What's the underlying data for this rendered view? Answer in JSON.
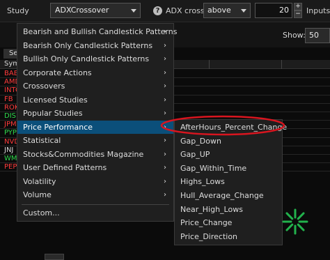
{
  "toolbar": {
    "study_label": "Study",
    "study_value": "ADXCrossover",
    "help_glyph": "?",
    "adx_label": "ADX crosses",
    "condition_value": "above",
    "threshold_value": "20",
    "stepper_up": "+",
    "stepper_down": "−",
    "inputs_label": "Inputs"
  },
  "view": {
    "show_label": "Show:",
    "show_value": "50"
  },
  "table": {
    "tab_label": "Sea",
    "symbol_header": "Sym",
    "rows": [
      {
        "symbol": "BABA",
        "status": "neg"
      },
      {
        "symbol": "AMD",
        "status": "neg"
      },
      {
        "symbol": "INTC",
        "status": "neg"
      },
      {
        "symbol": "FB",
        "status": "neg"
      },
      {
        "symbol": "ROKU",
        "status": "neg"
      },
      {
        "symbol": "DIS",
        "status": "pos"
      },
      {
        "symbol": "JPM",
        "status": "neg"
      },
      {
        "symbol": "PYPL",
        "status": "pos"
      },
      {
        "symbol": "NVDA",
        "status": "neg"
      },
      {
        "symbol": "JNJ",
        "status": "neu"
      },
      {
        "symbol": "WMT",
        "status": "pos"
      },
      {
        "symbol": "PEP",
        "status": "neg"
      }
    ]
  },
  "menu": {
    "items": [
      {
        "label": "Bearish and Bullish Candlestick Patterns",
        "submenu": true
      },
      {
        "label": "Bearish Only Candlestick Patterns",
        "submenu": true
      },
      {
        "label": "Bullish Only Candlestick Patterns",
        "submenu": true
      },
      {
        "label": "Corporate Actions",
        "submenu": true
      },
      {
        "label": "Crossovers",
        "submenu": true
      },
      {
        "label": "Licensed Studies",
        "submenu": true
      },
      {
        "label": "Popular Studies",
        "submenu": true
      },
      {
        "label": "Price Performance",
        "submenu": true,
        "active": true
      },
      {
        "label": "Statistical",
        "submenu": true
      },
      {
        "label": "Stocks&Commodities Magazine",
        "submenu": true
      },
      {
        "label": "User Defined Patterns",
        "submenu": true
      },
      {
        "label": "Volatility",
        "submenu": true
      },
      {
        "label": "Volume",
        "submenu": true
      }
    ],
    "custom_label": "Custom..."
  },
  "submenu": {
    "items": [
      "AfterHours_Percent_Change",
      "Gap_Down",
      "Gap_UP",
      "Gap_Within_Time",
      "Highs_Lows",
      "Hull_Average_Change",
      "Near_High_Lows",
      "Price_Change",
      "Price_Direction"
    ]
  },
  "colors": {
    "highlight": "#0b4f7a",
    "annotation": "#d9151f",
    "negative": "#ff3b3b",
    "positive": "#2ed94c",
    "loading": "#22b24c"
  },
  "icons": {
    "chevron": "chevron-right-icon",
    "help": "help-icon",
    "loading": "loading-spinner-icon"
  }
}
